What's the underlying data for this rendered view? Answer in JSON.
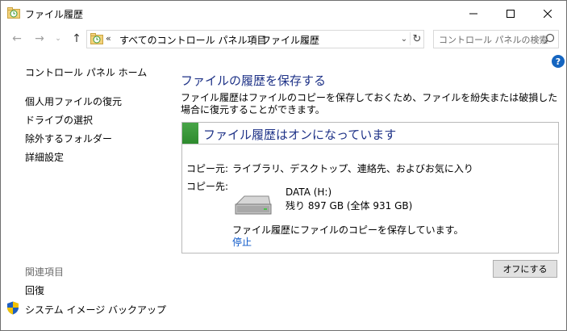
{
  "window": {
    "title": "ファイル履歴"
  },
  "address": {
    "overflow": "«",
    "crumbs": [
      "すべてのコントロール パネル項目",
      "ファイル履歴"
    ],
    "separator": "›"
  },
  "search": {
    "placeholder": "コントロール パネルの検索"
  },
  "sidebar": {
    "home": "コントロール パネル ホーム",
    "items": [
      {
        "label": "個人用ファイルの復元"
      },
      {
        "label": "ドライブの選択"
      },
      {
        "label": "除外するフォルダー"
      },
      {
        "label": "詳細設定"
      }
    ],
    "related_header": "関連項目",
    "related": [
      {
        "label": "回復"
      },
      {
        "label": "システム イメージ バックアップ"
      }
    ]
  },
  "main": {
    "heading": "ファイルの履歴を保存する",
    "description": "ファイル履歴はファイルのコピーを保存しておくため、ファイルを紛失または破損した場合に復元することができます。",
    "status": {
      "title": "ファイル履歴はオンになっています",
      "source_label": "コピー元:",
      "source_value": "ライブラリ、デスクトップ、連絡先、およびお気に入り",
      "dest_label": "コピー先:",
      "drive_name": "DATA (H:)",
      "drive_free": "残り 897 GB (全体 931 GB)",
      "saving_text": "ファイル履歴にファイルのコピーを保存しています。",
      "stop_link": "停止"
    },
    "off_button": "オフにする"
  },
  "colors": {
    "heading": "#1e3287",
    "link": "#0b57c9",
    "status_green": "#3a9a3a",
    "help_blue": "#1565c0"
  }
}
